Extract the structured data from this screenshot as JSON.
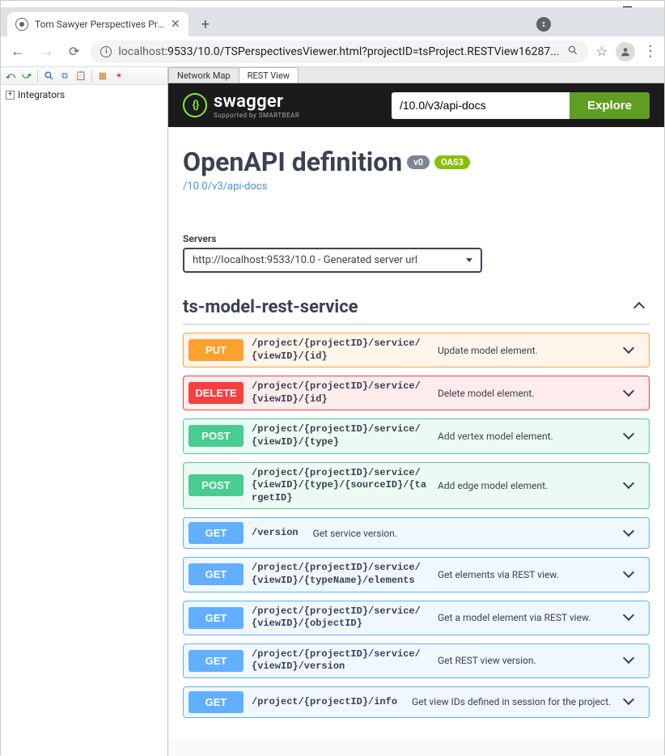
{
  "browser": {
    "tab_title": "Tom Sawyer Perspectives Preview",
    "url_host": "localhost",
    "url_port_path": ":9533/10.0/TSPerspectivesViewer.html?projectID=tsProject.RESTView16287..."
  },
  "left_panel": {
    "tree_root": "Integrators"
  },
  "view_tabs": {
    "tab1": "Network Map",
    "tab2": "REST View"
  },
  "swagger": {
    "brand": "swagger",
    "brand_sub": "Supported by SMARTBEAR",
    "input_value": "/10.0/v3/api-docs",
    "explore_label": "Explore",
    "title": "OpenAPI definition",
    "version_badge": "v0",
    "oas_badge": "OAS3",
    "docs_link": "/10.0/v3/api-docs",
    "servers_label": "Servers",
    "server_option": "http://localhost:9533/10.0 - Generated server url",
    "tag_name": "ts-model-rest-service",
    "ops": [
      {
        "method": "PUT",
        "cls": "op-put",
        "path": "/project/{projectID}/service/{viewID}/{id}",
        "desc": "Update model element."
      },
      {
        "method": "DELETE",
        "cls": "op-delete",
        "path": "/project/{projectID}/service/{viewID}/{id}",
        "desc": "Delete model element."
      },
      {
        "method": "POST",
        "cls": "op-post",
        "path": "/project/{projectID}/service/{viewID}/{type}",
        "desc": "Add vertex model element."
      },
      {
        "method": "POST",
        "cls": "op-post",
        "path": "/project/{projectID}/service/{viewID}/{type}/{sourceID}/{targetID}",
        "desc": "Add edge model element."
      },
      {
        "method": "GET",
        "cls": "op-get",
        "path": "/version",
        "desc": "Get service version.",
        "short": true
      },
      {
        "method": "GET",
        "cls": "op-get",
        "path": "/project/{projectID}/service/{viewID}/{typeName}/elements",
        "desc": "Get elements via REST view."
      },
      {
        "method": "GET",
        "cls": "op-get",
        "path": "/project/{projectID}/service/{viewID}/{objectID}",
        "desc": "Get a model element via REST view."
      },
      {
        "method": "GET",
        "cls": "op-get",
        "path": "/project/{projectID}/service/{viewID}/version",
        "desc": "Get REST view version."
      },
      {
        "method": "GET",
        "cls": "op-get",
        "path": "/project/{projectID}/info",
        "desc": "Get view IDs defined in session for the project.",
        "short": true
      }
    ]
  }
}
